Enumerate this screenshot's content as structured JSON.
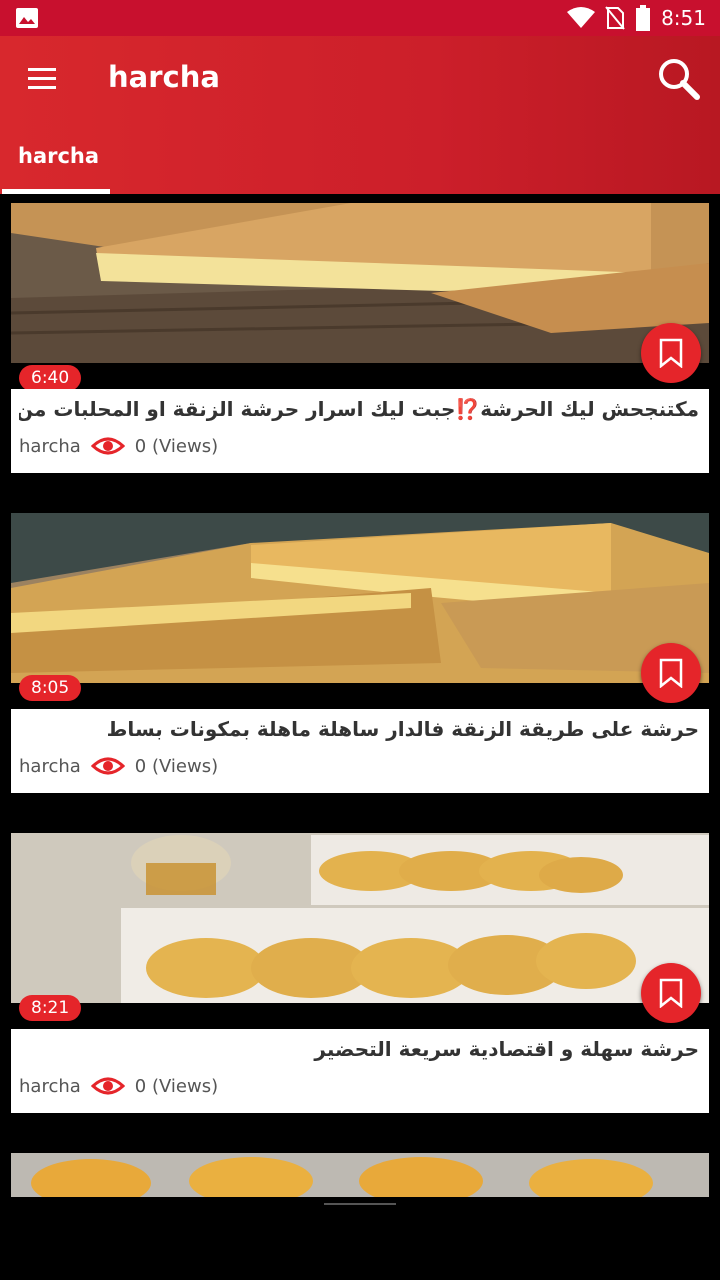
{
  "status": {
    "time": "8:51"
  },
  "toolbar": {
    "title": "harcha"
  },
  "tabs": [
    {
      "label": "harcha"
    }
  ],
  "videos": [
    {
      "duration": "6:40",
      "title": "مكتنجحش ليك الحرشة⁉️جبت ليك اسرار حرشة الزنقة او المحلبات من عند ..",
      "channel": "harcha",
      "views": "0 (Views)"
    },
    {
      "duration": "8:05",
      "title": "حرشة على طريقة الزنقة فالدار ساهلة ماهلة بمكونات بساط",
      "channel": "harcha",
      "views": "0 (Views)"
    },
    {
      "duration": "8:21",
      "title": "حرشة سهلة و اقتصادية سريعة التحضير",
      "channel": "harcha",
      "views": "0 (Views)"
    }
  ],
  "colors": {
    "primary": "#d8282d",
    "accent": "#e5252a"
  }
}
